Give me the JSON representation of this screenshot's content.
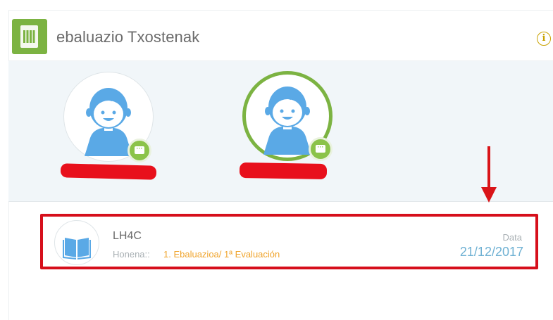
{
  "header": {
    "title": "ebaluazio Txostenak",
    "app_icon": "spreadsheet-icon",
    "info_icon": "info-icon",
    "info_glyph": "i",
    "accent_color": "#7cb342"
  },
  "students": [
    {
      "avatar_icon": "student-avatar-icon",
      "selected": false,
      "badge_icon": "chat-icon",
      "name_redacted": true
    },
    {
      "avatar_icon": "student-avatar-icon",
      "selected": true,
      "badge_icon": "chat-icon",
      "name_redacted": true
    }
  ],
  "annotation": {
    "arrow_color": "#d91418",
    "highlight_color": "#d60f1b"
  },
  "course": {
    "icon": "open-book-icon",
    "name": "LH4C",
    "term_label": "Honena::",
    "term_value": "1. Ebaluazioa/ 1ª Evaluación",
    "date_label": "Data",
    "date_value": "21/12/2017"
  }
}
